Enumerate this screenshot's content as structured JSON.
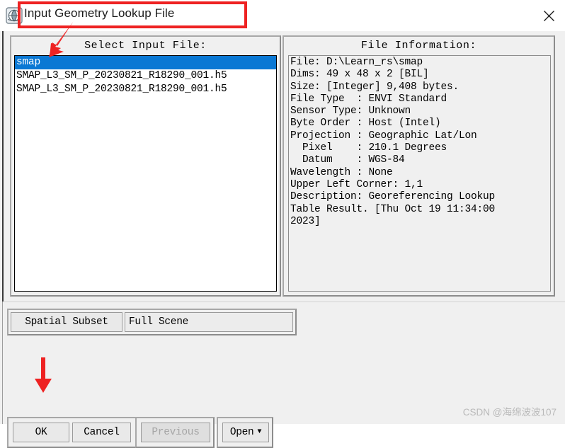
{
  "window": {
    "title": "Input Geometry Lookup File",
    "app_icon": "envi-globe-icon",
    "close_icon": "close-icon"
  },
  "select_panel": {
    "title": "Select Input File:",
    "items": [
      {
        "label": "smap",
        "selected": true
      },
      {
        "label": "SMAP_L3_SM_P_20230821_R18290_001.h5",
        "selected": false
      },
      {
        "label": "SMAP_L3_SM_P_20230821_R18290_001.h5",
        "selected": false
      }
    ]
  },
  "info_panel": {
    "title": "File Information:",
    "lines": [
      "File: D:\\Learn_rs\\smap",
      "Dims: 49 x 48 x 2 [BIL]",
      "Size: [Integer] 9,408 bytes.",
      "File Type  : ENVI Standard",
      "Sensor Type: Unknown",
      "Byte Order : Host (Intel)",
      "Projection : Geographic Lat/Lon",
      "  Pixel    : 210.1 Degrees",
      "  Datum    : WGS-84",
      "Wavelength : None",
      "Upper Left Corner: 1,1",
      "Description: Georeferencing Lookup",
      "Table Result. [Thu Oct 19 11:34:00",
      "2023]"
    ]
  },
  "subset": {
    "button_label": "Spatial Subset",
    "field_value": "Full Scene"
  },
  "buttons": {
    "ok": "OK",
    "cancel": "Cancel",
    "previous": "Previous",
    "open": "Open",
    "open_caret": "▼"
  },
  "watermark": "CSDN @海绵波波107",
  "annotations": {
    "highlight_color": "#ee2222",
    "title_box": "red-rectangle-around-title",
    "arrow_to_file_list": "red-arrow-down-left",
    "arrow_to_ok": "red-arrow-down"
  },
  "colors": {
    "selection_blue": "#0a78d4",
    "dialog_gray": "#f0f0f0",
    "annotation_red": "#ee2222"
  }
}
